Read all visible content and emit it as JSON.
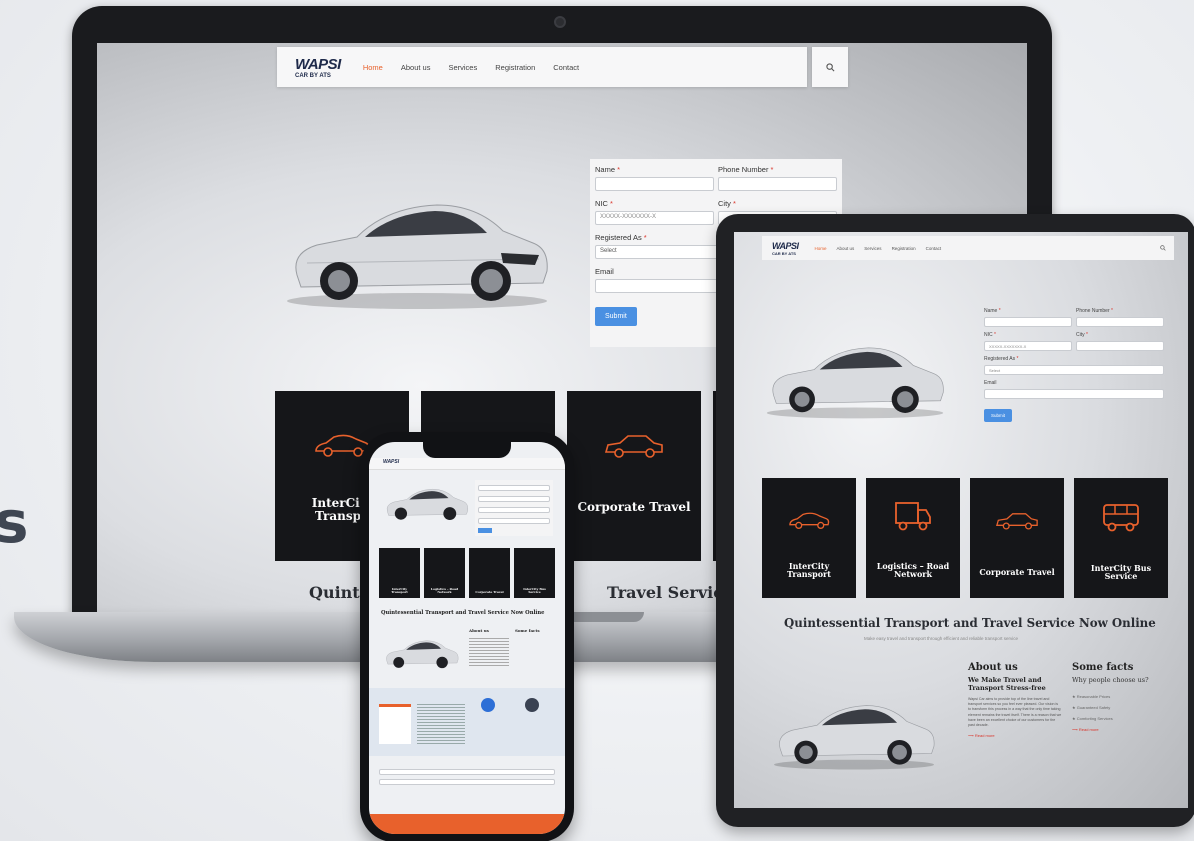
{
  "nav": {
    "logo_main": "WAPSI",
    "logo_sub": "CAR BY ATS",
    "items": [
      "Home",
      "About us",
      "Services",
      "Registration",
      "Contact"
    ]
  },
  "form": {
    "name_label": "Name",
    "phone_label": "Phone Number",
    "nic_label": "NIC",
    "nic_placeholder": "XXXXX-XXXXXXX-X",
    "city_label": "City",
    "registered_label": "Registered As",
    "registered_value": "Select",
    "email_label": "Email",
    "submit": "Submit",
    "required_mark": "*"
  },
  "services": [
    "InterCity Transport",
    "Logistics – Road Network",
    "Corporate Travel",
    "InterCity Bus Service"
  ],
  "tagline": "Quintessential Transport and Travel Service Now Online",
  "tagline_sub": "Make easy travel and transport through efficient and reliable transport service",
  "about": {
    "heading": "About us",
    "subheading": "We Make Travel and Transport Stress-free",
    "body": "Wapsi Car aims to provide top of the line travel and transport services so you feel ever pleased. Our vision is to transform this process in a way that the only time taking element remains the travel itself. There is a reason that we have been an excellent choice of our customers for the past decade.",
    "read_more": "Read more"
  },
  "facts": {
    "heading": "Some facts",
    "subheading": "Why people choose us?",
    "items": [
      "Reasonable Prices",
      "Guaranteed Safety",
      "Comforting Services"
    ]
  },
  "laptop_partial": {
    "tile_left": "InterCity Transpo",
    "tile_corporate": "Corporate Travel",
    "tagline_fragment_left": "Quint",
    "tagline_fragment_right": "Travel Service"
  },
  "colors": {
    "accent": "#e8612c",
    "tile_bg": "#151619",
    "submit_blue": "#4a90e2"
  }
}
